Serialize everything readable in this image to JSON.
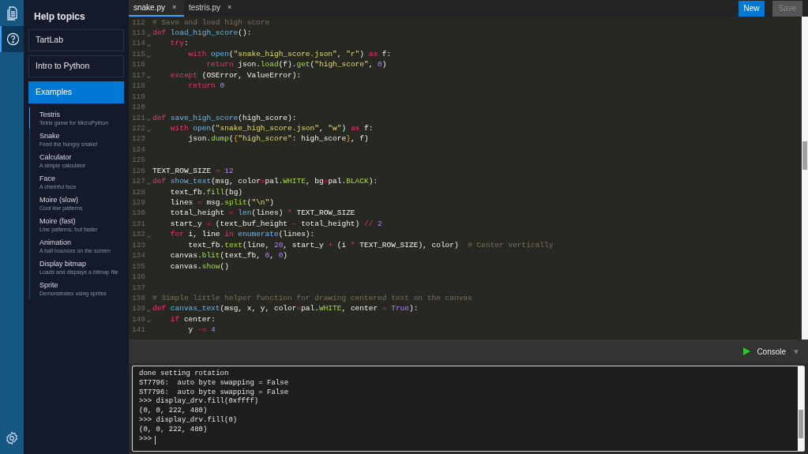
{
  "rail_items": [
    {
      "selected": false
    },
    {
      "selected": true
    }
  ],
  "help": {
    "title": "Help topics",
    "sections": [
      {
        "label": "TartLab",
        "selected": false
      },
      {
        "label": "Intro to Python",
        "selected": false
      },
      {
        "label": "Examples",
        "selected": true
      }
    ],
    "examples": [
      {
        "title": "Testris",
        "description": "Tetris game for MicroPython",
        "selected": true
      },
      {
        "title": "Snake",
        "description": "Feed the hungry snake!",
        "selected": false
      },
      {
        "title": "Calculator",
        "description": "A simple calculator",
        "selected": false
      },
      {
        "title": "Face",
        "description": "A cheerful face",
        "selected": false
      },
      {
        "title": "Moire (slow)",
        "description": "Cool line patterns",
        "selected": false
      },
      {
        "title": "Moire (fast)",
        "description": "Line patterns, but faster",
        "selected": false
      },
      {
        "title": "Animation",
        "description": "A ball bounces on the screen",
        "selected": false
      },
      {
        "title": "Display bitmap",
        "description": "Loads and displays a bitmap file",
        "selected": false
      },
      {
        "title": "Sprite",
        "description": "Demonstrates using sprites",
        "selected": false
      }
    ]
  },
  "tabs": [
    {
      "label": "snake.py",
      "close": "×",
      "selected": true
    },
    {
      "label": "testris.py",
      "close": "×",
      "selected": false
    }
  ],
  "buttons": [
    {
      "label": "New",
      "disabled": false
    },
    {
      "label": "Save",
      "disabled": true
    }
  ],
  "code": [
    {
      "number": "112",
      "fold": false,
      "tokens": [
        {
          "kind": "com",
          "text": "# Save and load high score"
        }
      ]
    },
    {
      "number": "113",
      "fold": true,
      "tokens": [
        {
          "kind": "kw",
          "text": "def"
        },
        {
          "kind": "fn",
          "text": " load_high_score"
        },
        {
          "kind": "plain",
          "text": "():"
        }
      ]
    },
    {
      "number": "114",
      "fold": true,
      "tokens": [
        {
          "kind": "kw",
          "text": "    try"
        },
        {
          "kind": "plain",
          "text": ":"
        }
      ]
    },
    {
      "number": "115",
      "fold": true,
      "tokens": [
        {
          "kind": "kw",
          "text": "        with"
        },
        {
          "kind": "fn",
          "text": " open"
        },
        {
          "kind": "plain",
          "text": "("
        },
        {
          "kind": "str",
          "text": "\"snake_high_score.json\""
        },
        {
          "kind": "plain",
          "text": ", "
        },
        {
          "kind": "str",
          "text": "\"r\""
        },
        {
          "kind": "plain",
          "text": ") "
        },
        {
          "kind": "kw",
          "text": "as"
        },
        {
          "kind": "plain",
          "text": " f:"
        }
      ]
    },
    {
      "number": "116",
      "fold": false,
      "tokens": [
        {
          "kind": "kw",
          "text": "            return"
        },
        {
          "kind": "plain",
          "text": " json."
        },
        {
          "kind": "meth",
          "text": "load"
        },
        {
          "kind": "plain",
          "text": "(f)."
        },
        {
          "kind": "meth",
          "text": "get"
        },
        {
          "kind": "plain",
          "text": "("
        },
        {
          "kind": "str",
          "text": "\"high_score\""
        },
        {
          "kind": "plain",
          "text": ", "
        },
        {
          "kind": "num",
          "text": "0"
        },
        {
          "kind": "plain",
          "text": ")"
        }
      ]
    },
    {
      "number": "117",
      "fold": true,
      "tokens": [
        {
          "kind": "kw",
          "text": "    except"
        },
        {
          "kind": "plain",
          "text": " (OSError, ValueError):"
        }
      ]
    },
    {
      "number": "118",
      "fold": false,
      "tokens": [
        {
          "kind": "kw",
          "text": "        return"
        },
        {
          "kind": "num",
          "text": " 0"
        }
      ]
    },
    {
      "number": "119",
      "fold": false
    },
    {
      "number": "120",
      "fold": false
    },
    {
      "number": "121",
      "fold": true,
      "tokens": [
        {
          "kind": "kw",
          "text": "def"
        },
        {
          "kind": "fn",
          "text": " save_high_score"
        },
        {
          "kind": "plain",
          "text": "(high_score):"
        }
      ]
    },
    {
      "number": "122",
      "fold": true,
      "tokens": [
        {
          "kind": "kw",
          "text": "    with"
        },
        {
          "kind": "fn",
          "text": " open"
        },
        {
          "kind": "plain",
          "text": "("
        },
        {
          "kind": "str",
          "text": "\"snake_high_score.json\""
        },
        {
          "kind": "plain",
          "text": ", "
        },
        {
          "kind": "str",
          "text": "\"w\""
        },
        {
          "kind": "plain",
          "text": ") "
        },
        {
          "kind": "kw",
          "text": "as"
        },
        {
          "kind": "plain",
          "text": " f:"
        }
      ]
    },
    {
      "number": "123",
      "fold": false,
      "tokens": [
        {
          "kind": "plain",
          "text": "        json."
        },
        {
          "kind": "meth",
          "text": "dump"
        },
        {
          "kind": "plain",
          "text": "("
        },
        {
          "kind": "brace",
          "text": "{"
        },
        {
          "kind": "str",
          "text": "\"high_score\""
        },
        {
          "kind": "plain",
          "text": ": high_score"
        },
        {
          "kind": "brace",
          "text": "}"
        },
        {
          "kind": "plain",
          "text": ", f)"
        }
      ]
    },
    {
      "number": "124",
      "fold": false
    },
    {
      "number": "125",
      "fold": false
    },
    {
      "number": "126",
      "fold": false,
      "tokens": [
        {
          "kind": "plain",
          "text": "TEXT_ROW_SIZE "
        },
        {
          "kind": "op",
          "text": "="
        },
        {
          "kind": "num",
          "text": " 12"
        }
      ]
    },
    {
      "number": "127",
      "fold": true,
      "tokens": [
        {
          "kind": "kw",
          "text": "def"
        },
        {
          "kind": "fn",
          "text": " show_text"
        },
        {
          "kind": "plain",
          "text": "(msg, color"
        },
        {
          "kind": "op",
          "text": "="
        },
        {
          "kind": "plain",
          "text": "pal."
        },
        {
          "kind": "meth",
          "text": "WHITE"
        },
        {
          "kind": "plain",
          "text": ", bg"
        },
        {
          "kind": "op",
          "text": "="
        },
        {
          "kind": "plain",
          "text": "pal."
        },
        {
          "kind": "meth",
          "text": "BLACK"
        },
        {
          "kind": "plain",
          "text": "):"
        }
      ]
    },
    {
      "number": "128",
      "fold": false,
      "tokens": [
        {
          "kind": "plain",
          "text": "    text_fb."
        },
        {
          "kind": "meth",
          "text": "fill"
        },
        {
          "kind": "plain",
          "text": "(bg)"
        }
      ]
    },
    {
      "number": "129",
      "fold": false,
      "tokens": [
        {
          "kind": "plain",
          "text": "    lines "
        },
        {
          "kind": "op",
          "text": "="
        },
        {
          "kind": "plain",
          "text": " msg."
        },
        {
          "kind": "meth",
          "text": "split"
        },
        {
          "kind": "plain",
          "text": "("
        },
        {
          "kind": "str",
          "text": "\"\\n\""
        },
        {
          "kind": "plain",
          "text": ")"
        }
      ]
    },
    {
      "number": "130",
      "fold": false,
      "tokens": [
        {
          "kind": "plain",
          "text": "    total_height "
        },
        {
          "kind": "op",
          "text": "="
        },
        {
          "kind": "fn",
          "text": " len"
        },
        {
          "kind": "plain",
          "text": "(lines) "
        },
        {
          "kind": "op",
          "text": "*"
        },
        {
          "kind": "plain",
          "text": " TEXT_ROW_SIZE"
        }
      ]
    },
    {
      "number": "131",
      "fold": false,
      "tokens": [
        {
          "kind": "plain",
          "text": "    start_y "
        },
        {
          "kind": "op",
          "text": "="
        },
        {
          "kind": "plain",
          "text": " (text_buf_height "
        },
        {
          "kind": "op",
          "text": "-"
        },
        {
          "kind": "plain",
          "text": " total_height) "
        },
        {
          "kind": "op",
          "text": "//"
        },
        {
          "kind": "num",
          "text": " 2"
        }
      ]
    },
    {
      "number": "132",
      "fold": true,
      "tokens": [
        {
          "kind": "kw",
          "text": "    for"
        },
        {
          "kind": "plain",
          "text": " i, line "
        },
        {
          "kind": "kw",
          "text": "in"
        },
        {
          "kind": "fn",
          "text": " enumerate"
        },
        {
          "kind": "plain",
          "text": "(lines):"
        }
      ]
    },
    {
      "number": "133",
      "fold": false,
      "tokens": [
        {
          "kind": "plain",
          "text": "        text_fb."
        },
        {
          "kind": "meth",
          "text": "text"
        },
        {
          "kind": "plain",
          "text": "(line, "
        },
        {
          "kind": "num",
          "text": "20"
        },
        {
          "kind": "plain",
          "text": ", start_y "
        },
        {
          "kind": "op",
          "text": "+"
        },
        {
          "kind": "plain",
          "text": " (i "
        },
        {
          "kind": "op",
          "text": "*"
        },
        {
          "kind": "plain",
          "text": " TEXT_ROW_SIZE), color)  "
        },
        {
          "kind": "com",
          "text": "# Center vertically"
        }
      ]
    },
    {
      "number": "134",
      "fold": false,
      "tokens": [
        {
          "kind": "plain",
          "text": "    canvas."
        },
        {
          "kind": "meth",
          "text": "blit"
        },
        {
          "kind": "plain",
          "text": "(text_fb, "
        },
        {
          "kind": "num",
          "text": "0"
        },
        {
          "kind": "plain",
          "text": ", "
        },
        {
          "kind": "num",
          "text": "0"
        },
        {
          "kind": "plain",
          "text": ")"
        }
      ]
    },
    {
      "number": "135",
      "fold": false,
      "tokens": [
        {
          "kind": "plain",
          "text": "    canvas."
        },
        {
          "kind": "meth",
          "text": "show"
        },
        {
          "kind": "plain",
          "text": "()"
        }
      ]
    },
    {
      "number": "136",
      "fold": false
    },
    {
      "number": "137",
      "fold": false
    },
    {
      "number": "138",
      "fold": false,
      "tokens": [
        {
          "kind": "com",
          "text": "# Simple little helper function for drawing centered text on the canvas"
        }
      ]
    },
    {
      "number": "139",
      "fold": true,
      "tokens": [
        {
          "kind": "kw",
          "text": "def"
        },
        {
          "kind": "fn",
          "text": " canvas_text"
        },
        {
          "kind": "plain",
          "text": "(msg, x, y, color"
        },
        {
          "kind": "op",
          "text": "="
        },
        {
          "kind": "plain",
          "text": "pal."
        },
        {
          "kind": "meth",
          "text": "WHITE"
        },
        {
          "kind": "plain",
          "text": ", center "
        },
        {
          "kind": "op",
          "text": "="
        },
        {
          "kind": "num",
          "text": " True"
        },
        {
          "kind": "plain",
          "text": "):"
        }
      ]
    },
    {
      "number": "140",
      "fold": true,
      "tokens": [
        {
          "kind": "kw",
          "text": "    if"
        },
        {
          "kind": "plain",
          "text": " center:"
        }
      ]
    },
    {
      "number": "141",
      "fold": false,
      "tokens": [
        {
          "kind": "plain",
          "text": "        y "
        },
        {
          "kind": "op",
          "text": "-="
        },
        {
          "kind": "num",
          "text": " 4"
        }
      ]
    }
  ],
  "console_bar": {
    "label": "Console",
    "caret": "▼"
  },
  "console": [
    "done setting rotation",
    "ST7796:  auto byte swapping = False",
    "ST7796:  auto byte swapping = False",
    ">>> display_drv.fill(0xffff)",
    "(0, 0, 222, 480)",
    ">>> display_drv.fill(0)",
    "(0, 0, 222, 480)",
    ">>>"
  ]
}
